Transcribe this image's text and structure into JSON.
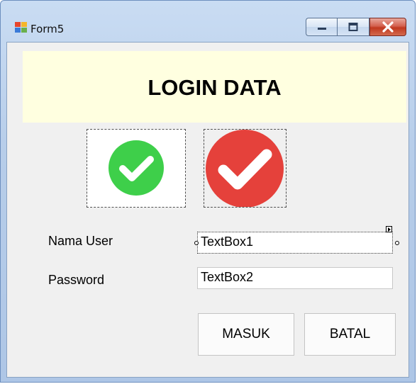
{
  "window": {
    "title": "Form5",
    "controls": {
      "minimize": "minimize",
      "maximize": "maximize",
      "close": "close"
    }
  },
  "banner": {
    "title": "LOGIN DATA",
    "background": "#ffffe0"
  },
  "pictures": [
    {
      "icon": "green-check-circle-icon",
      "color": "#3ecf4a"
    },
    {
      "icon": "red-check-circle-icon",
      "color": "#e5413b"
    }
  ],
  "form": {
    "username_label": "Nama User",
    "username_value": "TextBox1",
    "password_label": "Password",
    "password_value": "TextBox2"
  },
  "buttons": {
    "login": "MASUK",
    "cancel": "BATAL"
  }
}
